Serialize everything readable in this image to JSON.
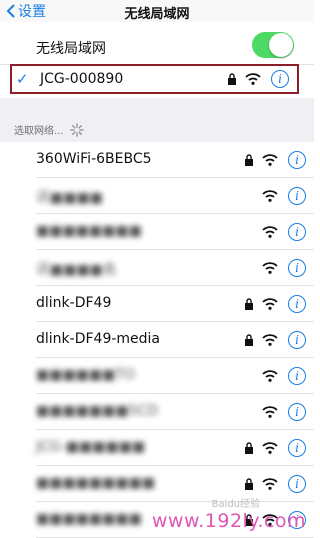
{
  "navbar": {
    "back_label": "设置",
    "title": "无线局域网"
  },
  "wlan": {
    "label": "无线局域网",
    "enabled": true
  },
  "connected": {
    "name": "JCG-000890",
    "secured": true
  },
  "section": {
    "header": "选取网络..."
  },
  "networks": [
    {
      "name": "360WiFi-6BEBC5",
      "secured": true,
      "obscured": false
    },
    {
      "name": "讯■■■■",
      "secured": false,
      "obscured": true
    },
    {
      "name": "■■■■■■■■",
      "secured": false,
      "obscured": true
    },
    {
      "name": "讯■■■■名",
      "secured": false,
      "obscured": true
    },
    {
      "name": "dlink-DF49",
      "secured": true,
      "obscured": false
    },
    {
      "name": "dlink-DF49-media",
      "secured": true,
      "obscured": false
    },
    {
      "name": "■■■■■■TO",
      "secured": false,
      "obscured": true
    },
    {
      "name": "■■■■■■■5CD",
      "secured": false,
      "obscured": true
    },
    {
      "name": "JCG-■■■■■■",
      "secured": true,
      "obscured": true
    },
    {
      "name": "■■■■■■■■■",
      "secured": true,
      "obscured": true
    },
    {
      "name": "■■■■■■■■",
      "secured": true,
      "obscured": true
    }
  ],
  "watermark": {
    "text": "www.192ly.com",
    "sub": "Baidu经验"
  },
  "colors": {
    "accent": "#1a7ee6",
    "toggle_on": "#4cd964",
    "highlight_border": "#8c1e2b"
  }
}
